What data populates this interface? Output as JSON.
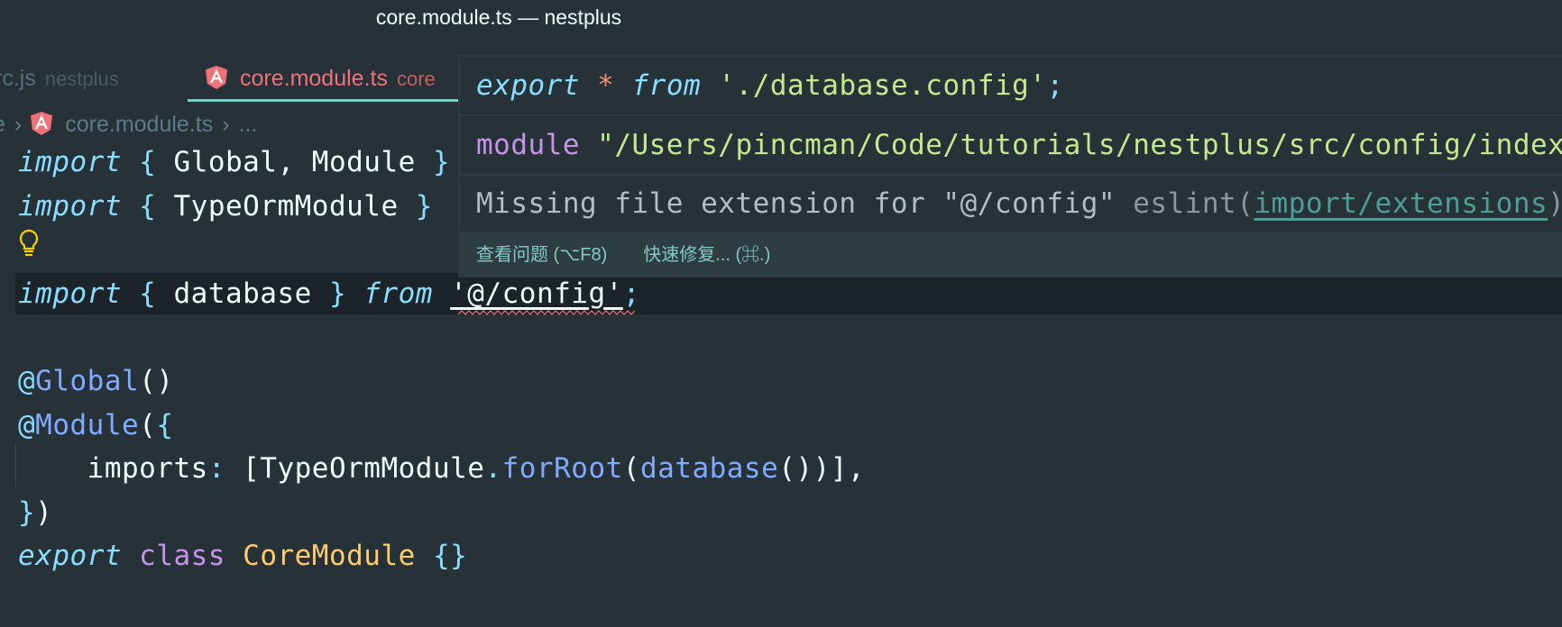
{
  "window": {
    "title": "core.module.ts — nestplus"
  },
  "tabs": [
    {
      "label": "rc.js",
      "description": "nestplus",
      "active": false
    },
    {
      "label": "core.module.ts",
      "description": "core",
      "active": true,
      "icon": "angular-icon"
    }
  ],
  "breadcrumb": {
    "items": [
      "e",
      "core.module.ts",
      "..."
    ],
    "icon": "angular-icon"
  },
  "colors": {
    "background": "#263238",
    "accent": "#80cbc4",
    "active_tab": "#f07178",
    "error": "#e06c75"
  },
  "code": {
    "lines": [
      [
        [
          "kw",
          "import"
        ],
        [
          "id",
          " "
        ],
        [
          "punc",
          "{"
        ],
        [
          "id",
          " Global, Module "
        ],
        [
          "punc",
          "}"
        ]
      ],
      [
        [
          "kw",
          "import"
        ],
        [
          "id",
          " "
        ],
        [
          "punc",
          "{"
        ],
        [
          "id",
          " TypeOrmModule "
        ],
        [
          "punc",
          "}"
        ]
      ],
      [],
      [
        [
          "kw",
          "import"
        ],
        [
          "id",
          " "
        ],
        [
          "punc",
          "{"
        ],
        [
          "id",
          " database "
        ],
        [
          "punc",
          "}"
        ],
        [
          "id",
          " "
        ],
        [
          "kw",
          "from"
        ],
        [
          "id",
          " "
        ],
        [
          "str-hover",
          "'@/config'"
        ],
        [
          "punc",
          ";"
        ]
      ],
      [],
      [
        [
          "dec",
          "@"
        ],
        [
          "fn",
          "Global"
        ],
        [
          "id",
          "()"
        ]
      ],
      [
        [
          "dec",
          "@"
        ],
        [
          "fn",
          "Module"
        ],
        [
          "id",
          "("
        ],
        [
          "punc",
          "{"
        ]
      ],
      [
        [
          "id",
          "    imports"
        ],
        [
          "punc",
          ":"
        ],
        [
          "id",
          " [TypeOrmModule"
        ],
        [
          "punc",
          "."
        ],
        [
          "fn",
          "forRoot"
        ],
        [
          "id",
          "("
        ],
        [
          "fn",
          "database"
        ],
        [
          "id",
          "())],"
        ]
      ],
      [
        [
          "punc",
          "}"
        ],
        [
          "id",
          ")"
        ]
      ],
      [
        [
          "kw",
          "export"
        ],
        [
          "id",
          " "
        ],
        [
          "storage",
          "class"
        ],
        [
          "id",
          " "
        ],
        [
          "cls",
          "CoreModule"
        ],
        [
          "id",
          " "
        ],
        [
          "punc",
          "{}"
        ]
      ]
    ]
  },
  "hover": {
    "row1": [
      [
        "kw",
        "export"
      ],
      [
        "id",
        " "
      ],
      [
        "star",
        "*"
      ],
      [
        "id",
        " "
      ],
      [
        "kw",
        "from"
      ],
      [
        "id",
        " "
      ],
      [
        "str",
        "'./database.config'"
      ],
      [
        "punc",
        ";"
      ]
    ],
    "row2": [
      [
        "storage",
        "module"
      ],
      [
        "id",
        " "
      ],
      [
        "str",
        "\"/Users/pincman/Code/tutorials/nestplus/src/config/index\""
      ]
    ],
    "message": "Missing file extension for \"@/config\"",
    "source": "eslint(",
    "rule": "import/extensions",
    "source_end": ")",
    "actions": [
      "查看问题 (⌥F8)",
      "快速修复... (⌘.)"
    ]
  }
}
